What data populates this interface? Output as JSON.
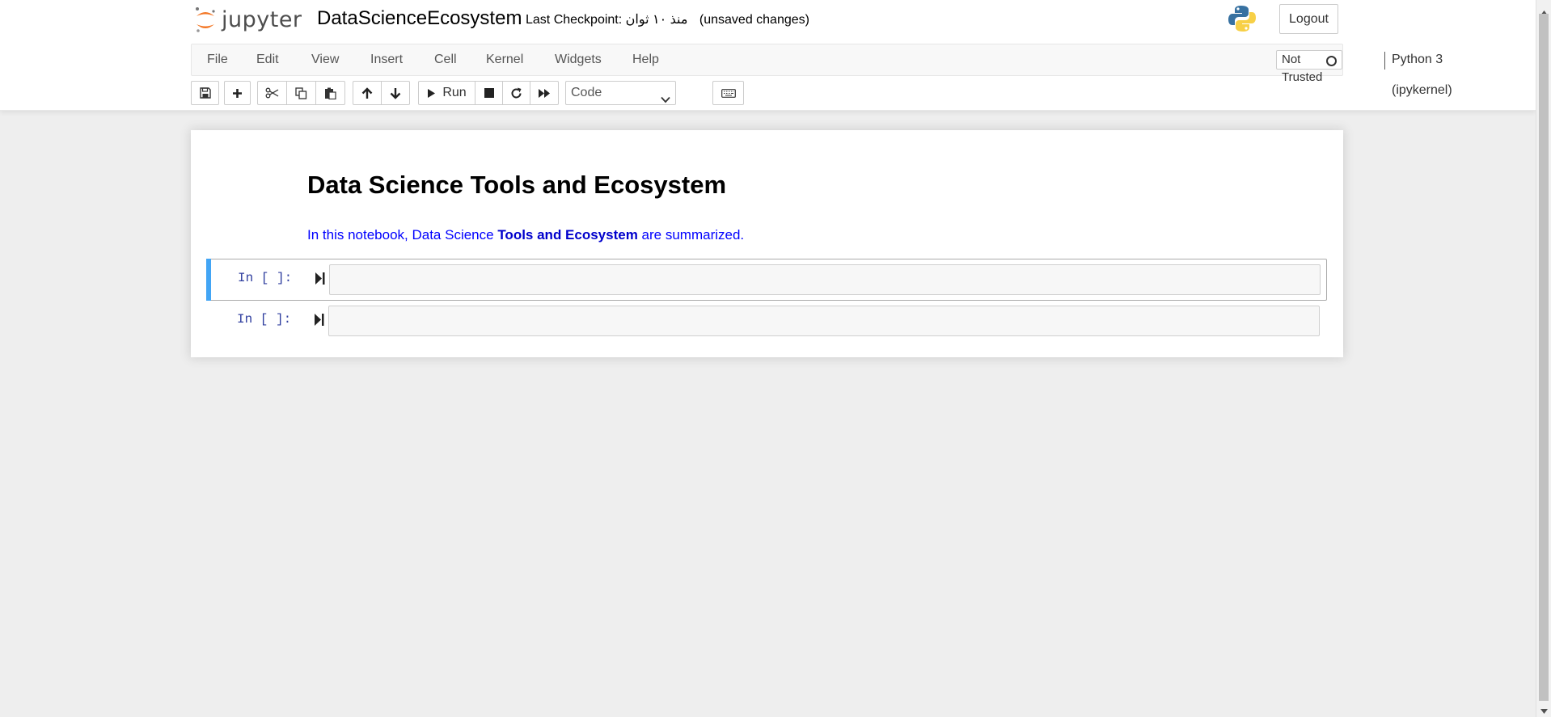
{
  "header": {
    "logo_text": "jupyter",
    "notebook_name": "DataScienceEcosystem",
    "checkpoint_label": "Last Checkpoint:",
    "checkpoint_time": "منذ ١٠ ثوان",
    "autosave_status": "(unsaved changes)",
    "logout_label": "Logout"
  },
  "menubar": {
    "items": [
      "File",
      "Edit",
      "View",
      "Insert",
      "Cell",
      "Kernel",
      "Widgets",
      "Help"
    ],
    "trust_label": "Not Trusted",
    "kernel_name": "Python 3 (ipykernel)"
  },
  "toolbar": {
    "run_label": "Run",
    "cell_type": "Code",
    "icons": [
      "save-icon",
      "plus-icon",
      "cut-icon",
      "copy-icon",
      "paste-icon",
      "arrow-up-icon",
      "arrow-down-icon",
      "run-icon",
      "stop-icon",
      "restart-icon",
      "fast-forward-icon",
      "keyboard-icon"
    ]
  },
  "notebook": {
    "heading": "Data Science Tools and Ecosystem",
    "paragraph_start": "In this notebook, Data Science ",
    "paragraph_bold": "Tools and Ecosystem",
    "paragraph_end": " are summarized.",
    "cells": [
      {
        "prompt": "In [ ]:",
        "selected": true,
        "source": ""
      },
      {
        "prompt": "In [ ]:",
        "selected": false,
        "source": ""
      }
    ]
  },
  "colors": {
    "accent_selected": "#42a5f5",
    "prompt_color": "#303f9f",
    "markdown_text": "#0000ff",
    "logo_orange": "#f37726"
  }
}
